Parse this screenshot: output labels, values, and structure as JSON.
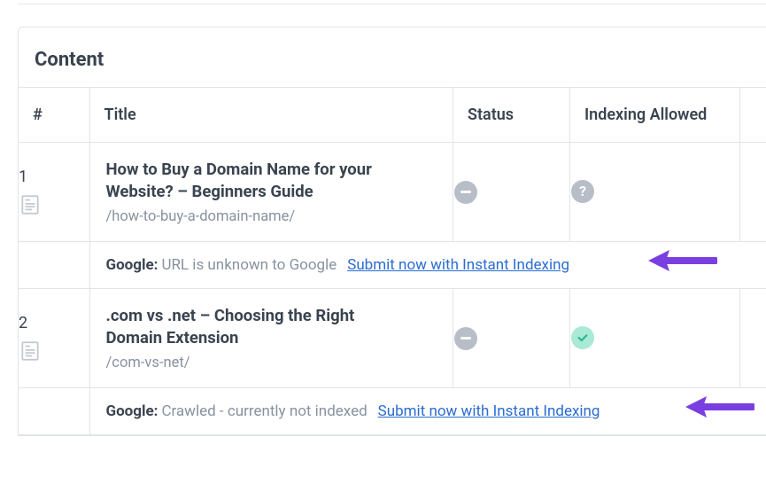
{
  "panel": {
    "title": "Content"
  },
  "columns": {
    "num": "#",
    "title": "Title",
    "status": "Status",
    "index": "Indexing Allowed"
  },
  "rows": [
    {
      "num": "1",
      "title": "How to Buy a Domain Name for your Website? – Beginners Guide",
      "slug": "/how-to-buy-a-domain-name/",
      "status_icon": "minus",
      "index_icon": "question",
      "meta_label": "Google:",
      "meta_value": "URL is unknown to Google",
      "submit": "Submit now with Instant Indexing"
    },
    {
      "num": "2",
      "title": ".com vs .net – Choosing the Right Domain Extension",
      "slug": "/com-vs-net/",
      "status_icon": "minus",
      "index_icon": "check",
      "meta_label": "Google:",
      "meta_value": "Crawled - currently not indexed",
      "submit": "Submit now with Instant Indexing"
    }
  ],
  "colors": {
    "link": "#2b6cd1",
    "arrow": "#7a3fe0",
    "badge_gray": "#b7bec7",
    "badge_green": "#a9e9d6"
  }
}
